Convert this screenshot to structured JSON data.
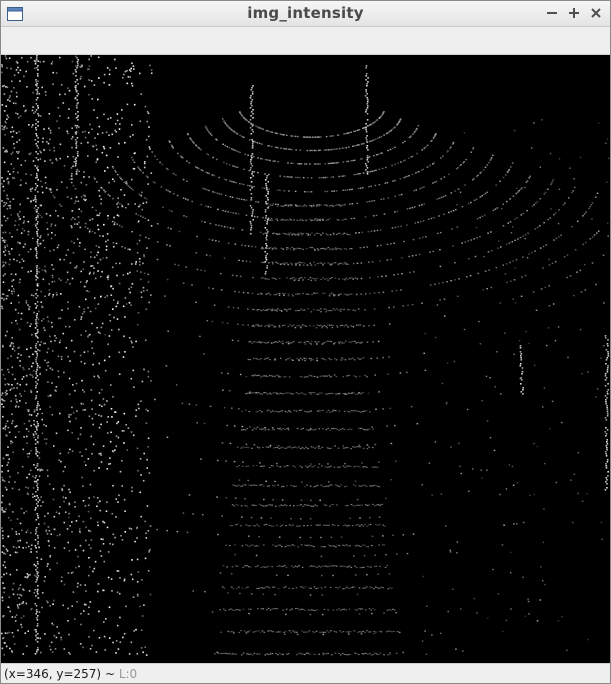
{
  "window": {
    "title": "img_intensity",
    "app_icon": "window-icon",
    "controls": {
      "minimize": "minimize-icon",
      "maximize": "maximize-icon",
      "close": "close-icon"
    }
  },
  "image": {
    "name": "intensity-image",
    "description_type": "lidar-intensity"
  },
  "status": {
    "coords": "(x=346, y=257)",
    "separator": " ~ ",
    "level": "L:0"
  },
  "colors": {
    "title_text": "#4a4a4a",
    "status_level": "#9a9a9a",
    "image_bg": "#000000"
  }
}
